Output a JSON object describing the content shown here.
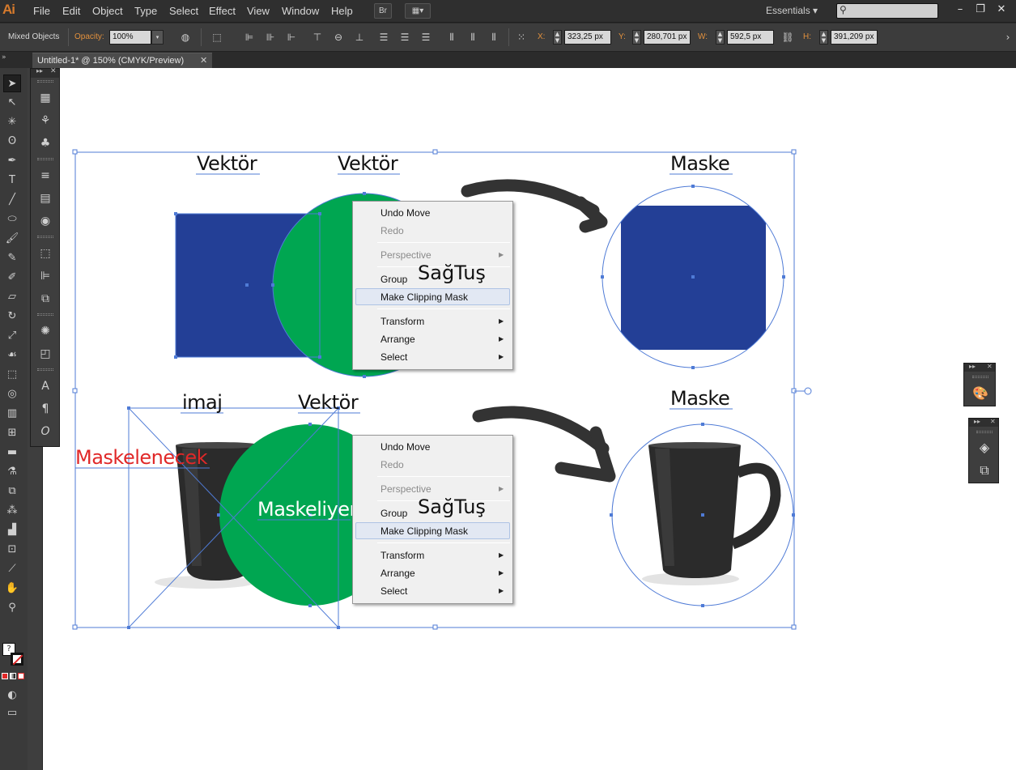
{
  "menubar": {
    "logo": "Ai",
    "items": [
      "File",
      "Edit",
      "Object",
      "Type",
      "Select",
      "Effect",
      "View",
      "Window",
      "Help"
    ],
    "bridge_label": "Br",
    "workspace": "Essentials"
  },
  "controlbar": {
    "selection_label": "Mixed Objects",
    "opacity_label": "Opacity:",
    "opacity_value": "100%",
    "x_label": "X:",
    "x_value": "323,25 px",
    "y_label": "Y:",
    "y_value": "280,701 px",
    "w_label": "W:",
    "w_value": "592,5 px",
    "h_label": "H:",
    "h_value": "391,209 px"
  },
  "document": {
    "tab_title": "Untitled-1* @ 150% (CMYK/Preview)"
  },
  "artwork": {
    "label_vektor_1": "Vektör",
    "label_vektor_2": "Vektör",
    "label_maske_1": "Maske",
    "label_imaj": "imaj",
    "label_vektor_3": "Vektör",
    "label_maske_2": "Maske",
    "label_maskelenecek": "Maskelenecek",
    "label_maskeliyen": "Maskeliyen",
    "label_sagtus_1": "SağTuş",
    "label_sagtus_2": "SağTuş",
    "colors": {
      "blue": "#233f96",
      "green": "#00a651",
      "selection": "#4f7bd6",
      "label_red": "#e02828"
    }
  },
  "context_menu": {
    "items": [
      {
        "label": "Undo Move",
        "enabled": true
      },
      {
        "label": "Redo",
        "enabled": false
      },
      {
        "label": "Perspective",
        "enabled": false,
        "submenu": true
      },
      {
        "label": "Group",
        "enabled": true
      },
      {
        "label": "Make Clipping Mask",
        "enabled": true,
        "highlighted": true
      },
      {
        "label": "Transform",
        "enabled": true,
        "submenu": true
      },
      {
        "label": "Arrange",
        "enabled": true,
        "submenu": true
      },
      {
        "label": "Select",
        "enabled": true,
        "submenu": true
      }
    ]
  },
  "icons": {
    "selection_tool": "selection-arrow-icon",
    "search": "search-icon",
    "appearance_panel": "palette-icon",
    "layers_panel": "layers-icon",
    "artboards_panel": "artboards-icon"
  }
}
